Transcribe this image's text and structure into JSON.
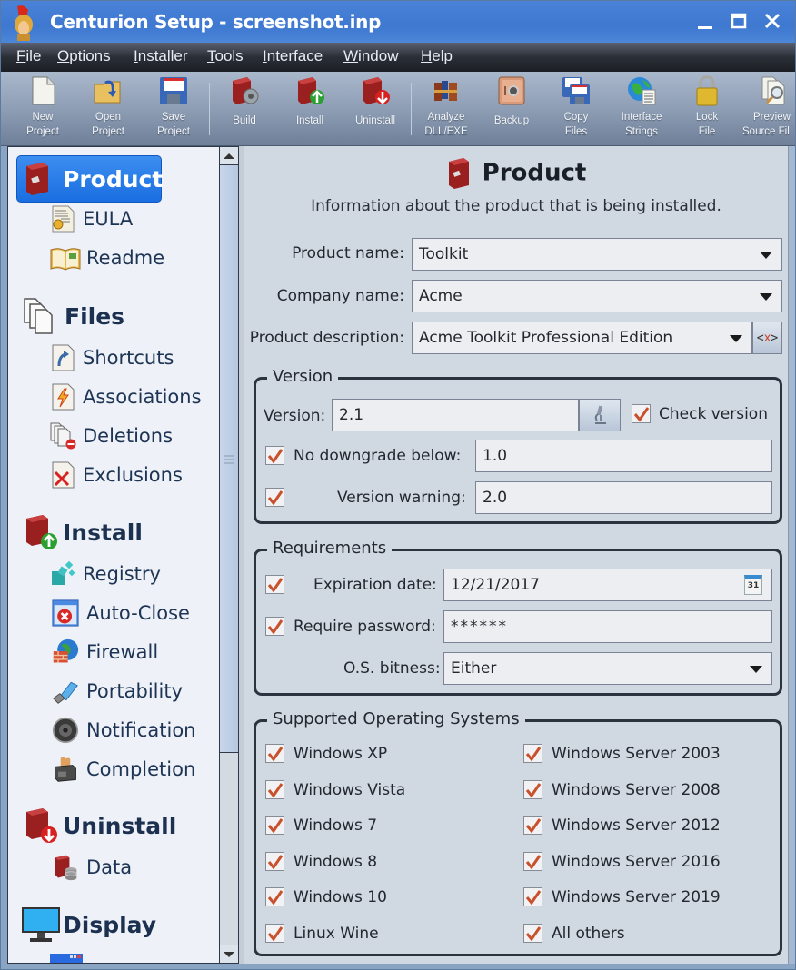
{
  "window": {
    "title": "Centurion Setup - screenshot.inp",
    "controls": {
      "minimize": "_",
      "maximize": "□",
      "close": "✕"
    }
  },
  "menu": [
    {
      "label": "File",
      "underline": "F",
      "rest": "ile"
    },
    {
      "label": "Options",
      "underline": "O",
      "rest": "ptions"
    },
    {
      "label": "Installer",
      "underline": "I",
      "rest": "nstaller"
    },
    {
      "label": "Tools",
      "underline": "T",
      "rest": "ools"
    },
    {
      "label": "Interface",
      "underline": "I",
      "rest": "nterface"
    },
    {
      "label": "Window",
      "underline": "W",
      "rest": "indow"
    },
    {
      "label": "Help",
      "underline": "H",
      "rest": "elp"
    }
  ],
  "toolbar": [
    {
      "line1": "New",
      "line2": "Project",
      "icon": "new-document-icon"
    },
    {
      "line1": "Open",
      "line2": "Project",
      "icon": "open-folder-icon"
    },
    {
      "line1": "Save",
      "line2": "Project",
      "icon": "floppy-disk-icon"
    },
    {
      "line1": "Build",
      "line2": "",
      "icon": "box-gear-icon"
    },
    {
      "line1": "Install",
      "line2": "",
      "icon": "box-up-arrow-icon"
    },
    {
      "line1": "Uninstall",
      "line2": "",
      "icon": "box-down-arrow-icon"
    },
    {
      "line1": "Analyze",
      "line2": "DLL/EXE",
      "icon": "books-icon"
    },
    {
      "line1": "Backup",
      "line2": "",
      "icon": "safe-icon"
    },
    {
      "line1": "Copy",
      "line2": "Files",
      "icon": "floppy-stack-icon"
    },
    {
      "line1": "Interface",
      "line2": "Strings",
      "icon": "globe-document-icon"
    },
    {
      "line1": "Lock",
      "line2": "File",
      "icon": "padlock-icon"
    },
    {
      "line1": "Preview",
      "line2": "Source Fil",
      "icon": "magnifier-documents-icon"
    }
  ],
  "sidebar": {
    "sections": [
      {
        "label": "Product",
        "active": true,
        "items": [
          "EULA",
          "Readme"
        ]
      },
      {
        "label": "Files",
        "active": false,
        "items": [
          "Shortcuts",
          "Associations",
          "Deletions",
          "Exclusions"
        ]
      },
      {
        "label": "Install",
        "active": false,
        "items": [
          "Registry",
          "Auto-Close",
          "Firewall",
          "Portability",
          "Notification",
          "Completion"
        ]
      },
      {
        "label": "Uninstall",
        "active": false,
        "items": [
          "Data"
        ]
      },
      {
        "label": "Display",
        "active": false,
        "items": []
      }
    ]
  },
  "page": {
    "title": "Product",
    "subtitle": "Information about the product that is being installed.",
    "product_name": {
      "label": "Product name:",
      "value": "Toolkit"
    },
    "company_name": {
      "label": "Company name:",
      "value": "Acme"
    },
    "product_description": {
      "label": "Product description:",
      "value": "Acme Toolkit Professional Edition",
      "var_button": "<x>"
    },
    "version_group": {
      "title": "Version",
      "version": {
        "label": "Version:",
        "value": "2.1"
      },
      "check_version": {
        "label": "Check version",
        "checked": true
      },
      "no_downgrade": {
        "label": "No downgrade below:",
        "checked": true,
        "value": "1.0"
      },
      "version_warning": {
        "label": "Version warning:",
        "checked": true,
        "value": "2.0"
      }
    },
    "requirements_group": {
      "title": "Requirements",
      "expiration": {
        "label": "Expiration date:",
        "checked": true,
        "value": "12/21/2017",
        "calendar_day": "31"
      },
      "password": {
        "label": "Require password:",
        "checked": true,
        "value": "******"
      },
      "bitness": {
        "label": "O.S. bitness:",
        "value": "Either"
      }
    },
    "os_group": {
      "title": "Supported Operating Systems",
      "left": [
        {
          "label": "Windows XP",
          "checked": true
        },
        {
          "label": "Windows Vista",
          "checked": true
        },
        {
          "label": "Windows 7",
          "checked": true
        },
        {
          "label": "Windows 8",
          "checked": true
        },
        {
          "label": "Windows 10",
          "checked": true
        },
        {
          "label": "Linux Wine",
          "checked": true
        }
      ],
      "right": [
        {
          "label": "Windows Server 2003",
          "checked": true
        },
        {
          "label": "Windows Server 2008",
          "checked": true
        },
        {
          "label": "Windows Server 2012",
          "checked": true
        },
        {
          "label": "Windows Server 2016",
          "checked": true
        },
        {
          "label": "Windows Server 2019",
          "checked": true
        },
        {
          "label": "All others",
          "checked": true
        }
      ]
    }
  },
  "colors": {
    "titlebar": "#3e78d0",
    "active_nav": "#1a6ee0",
    "checkmark": "#c8502a",
    "panel_bg": "#d0d8e2",
    "sidebar_bg": "#eef2f8"
  }
}
